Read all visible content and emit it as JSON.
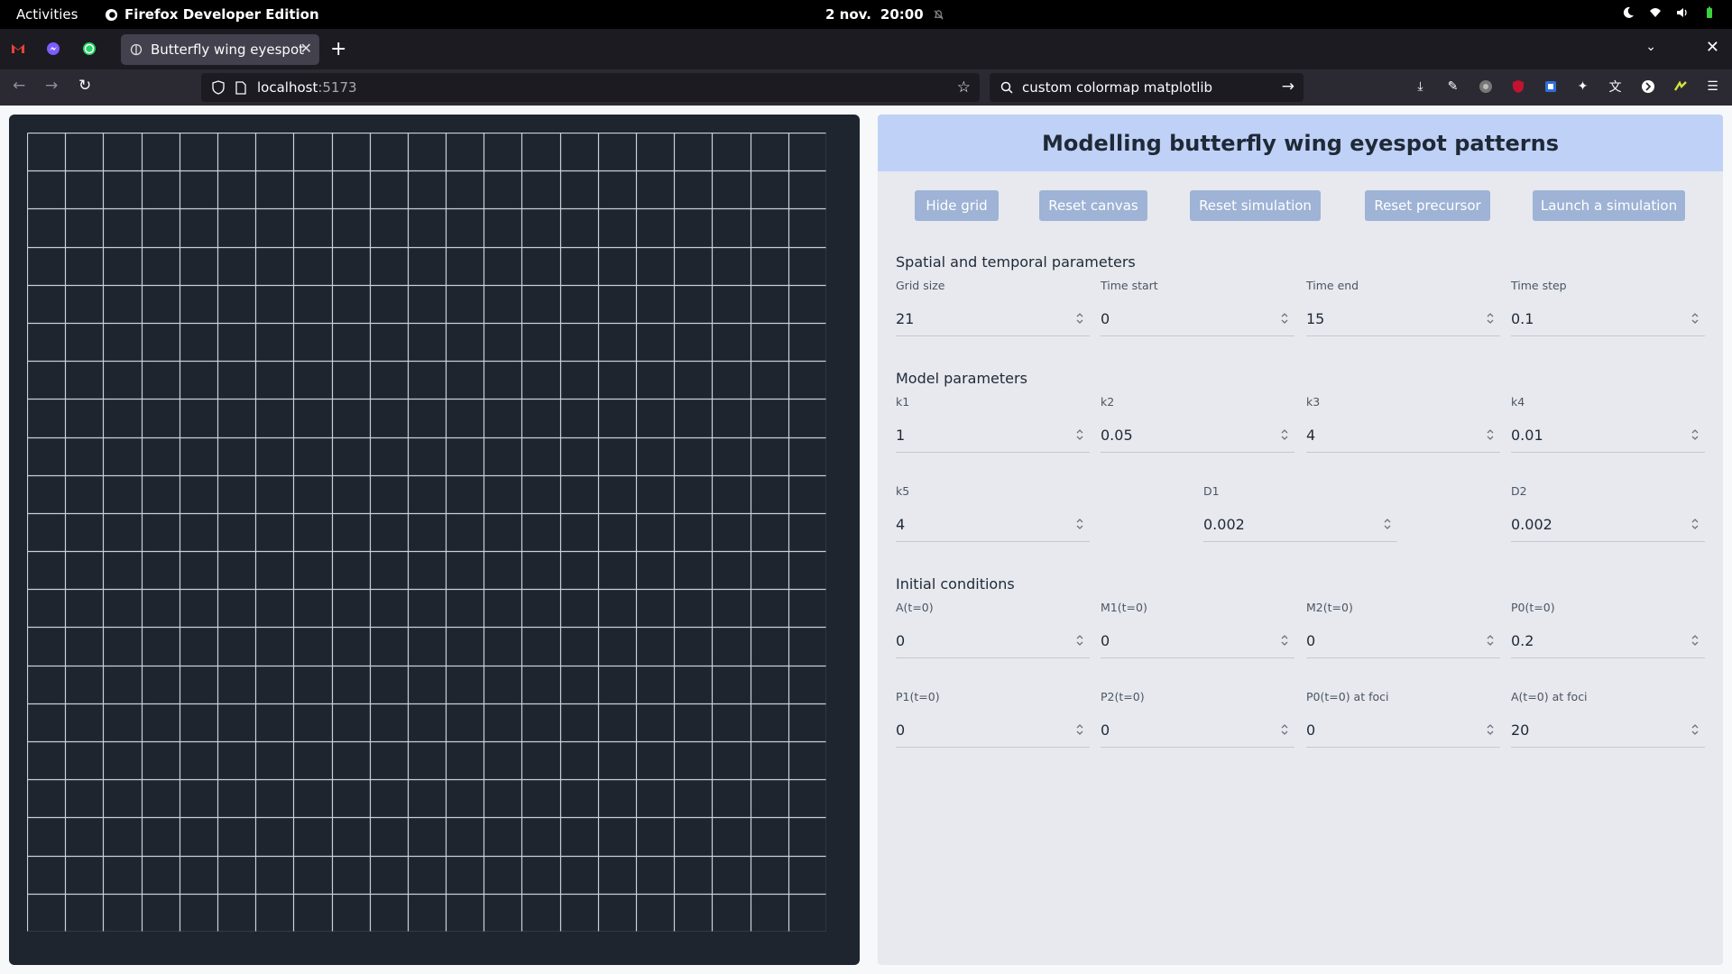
{
  "system": {
    "activities": "Activities",
    "app_name": "Firefox Developer Edition",
    "date": "2 nov.",
    "time": "20:00"
  },
  "browser": {
    "pinned_tabs": [
      "gmail-icon",
      "messenger-icon",
      "whatsapp-icon"
    ],
    "active_tab": {
      "title": "Butterfly wing eyespot"
    },
    "url_host": "localhost",
    "url_port": ":5173",
    "search_text": "custom colormap matplotlib",
    "toolbar_icons": [
      "download-icon",
      "wrench-icon",
      "extension-icon",
      "ublock-icon",
      "container-icon",
      "devtools-icon",
      "translate-icon",
      "extension-icon",
      "extension-icon",
      "menu-icon"
    ]
  },
  "canvas": {
    "grid_size": 21,
    "grid_visible": true,
    "background_color": "#1e252e",
    "grid_color": "#c9d0d8"
  },
  "panel": {
    "title": "Modelling butterfly wing eyespot patterns",
    "buttons": {
      "hide_grid": "Hide grid",
      "reset_canvas": "Reset canvas",
      "reset_simulation": "Reset simulation",
      "reset_precursor": "Reset precursor",
      "launch_simulation": "Launch a simulation"
    },
    "spatial": {
      "title": "Spatial and temporal parameters",
      "grid_size": {
        "label": "Grid size",
        "value": "21"
      },
      "time_start": {
        "label": "Time start",
        "value": "0"
      },
      "time_end": {
        "label": "Time end",
        "value": "15"
      },
      "time_step": {
        "label": "Time step",
        "value": "0.1"
      }
    },
    "model": {
      "title": "Model parameters",
      "k1": {
        "label": "k1",
        "value": "1"
      },
      "k2": {
        "label": "k2",
        "value": "0.05"
      },
      "k3": {
        "label": "k3",
        "value": "4"
      },
      "k4": {
        "label": "k4",
        "value": "0.01"
      },
      "k5": {
        "label": "k5",
        "value": "4"
      },
      "D1": {
        "label": "D1",
        "value": "0.002"
      },
      "D2": {
        "label": "D2",
        "value": "0.002"
      }
    },
    "initial": {
      "title": "Initial conditions",
      "A0": {
        "label": "A(t=0)",
        "value": "0"
      },
      "M1_0": {
        "label": "M1(t=0)",
        "value": "0"
      },
      "M2_0": {
        "label": "M2(t=0)",
        "value": "0"
      },
      "P0_0": {
        "label": "P0(t=0)",
        "value": "0.2"
      },
      "P1_0": {
        "label": "P1(t=0)",
        "value": "0"
      },
      "P2_0": {
        "label": "P2(t=0)",
        "value": "0"
      },
      "P0_foci": {
        "label": "P0(t=0) at foci",
        "value": "0"
      },
      "A_foci": {
        "label": "A(t=0) at foci",
        "value": "20"
      }
    }
  }
}
